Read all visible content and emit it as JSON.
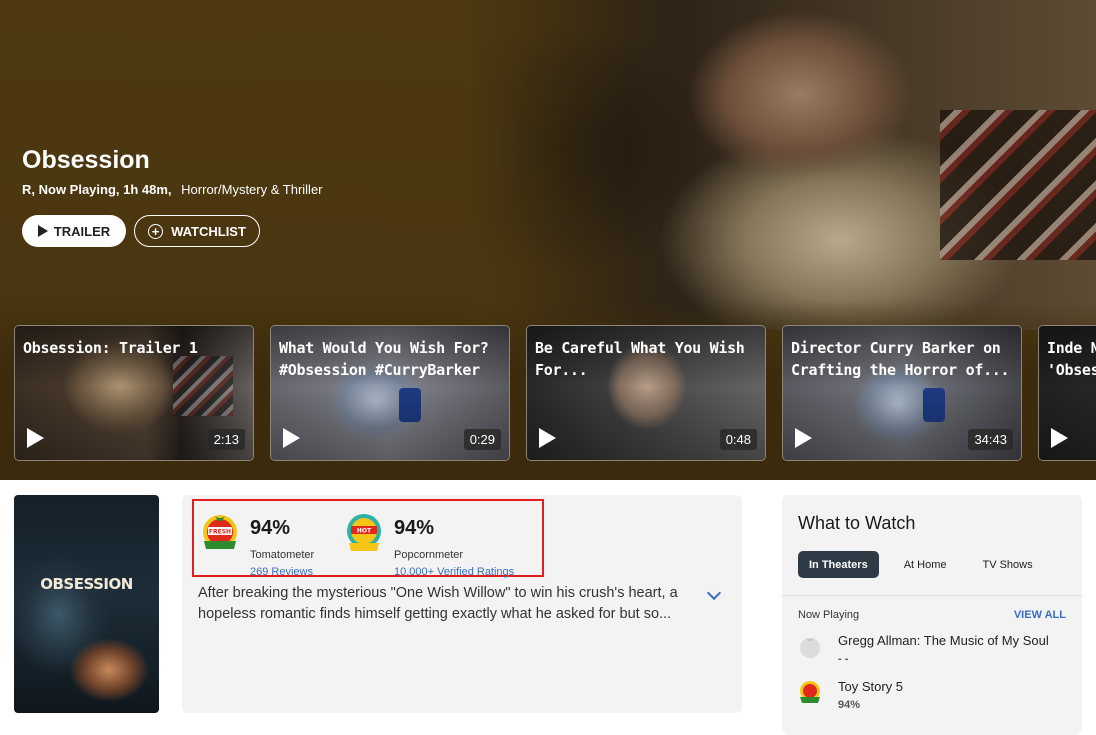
{
  "movie": {
    "title": "Obsession",
    "meta_strong": "R, Now Playing, 1h 48m,",
    "genres": "Horror/Mystery & Thriller",
    "trailer_label": "TRAILER",
    "watchlist_label": "WATCHLIST",
    "poster_title": "OBSESSION"
  },
  "videos": [
    {
      "title": "Obsession: Trailer 1",
      "duration": "2:13"
    },
    {
      "title": "What Would You Wish For?\n#Obsession #CurryBarker",
      "duration": "0:29"
    },
    {
      "title": "Be Careful What You Wish\nFor...",
      "duration": "0:48"
    },
    {
      "title": "Director Curry Barker on\nCrafting the Horror of...",
      "duration": "34:43"
    },
    {
      "title": "Inde N\n'Obses",
      "duration": ""
    }
  ],
  "scores": {
    "tomatometer": {
      "percent": "94%",
      "label": "Tomatometer",
      "link": "269 Reviews",
      "badge_icon": "certified-fresh-icon"
    },
    "popcornmeter": {
      "percent": "94%",
      "label": "Popcornmeter",
      "link": "10,000+ Verified Ratings",
      "badge_icon": "verified-hot-icon"
    }
  },
  "synopsis": "After breaking the mysterious \"One Wish Willow\" to win his crush's heart, a hopeless romantic finds himself getting exactly what he asked for but so...",
  "what_to_watch": {
    "title": "What to Watch",
    "tabs": [
      {
        "label": "In Theaters",
        "active": true
      },
      {
        "label": "At Home",
        "active": false
      },
      {
        "label": "TV Shows",
        "active": false
      }
    ],
    "section_label": "Now Playing",
    "view_all": "VIEW ALL",
    "items": [
      {
        "name": "Gregg Allman: The Music of My Soul",
        "score": "- -",
        "icon": "empty-tomato-icon"
      },
      {
        "name": "Toy Story 5",
        "score": "94%",
        "icon": "certified-fresh-icon"
      }
    ]
  },
  "colors": {
    "hero_bg": "#4a3710",
    "highlight_border": "#e01e1e",
    "link_blue": "#3a6ec2",
    "active_tab": "#2e3a45"
  }
}
